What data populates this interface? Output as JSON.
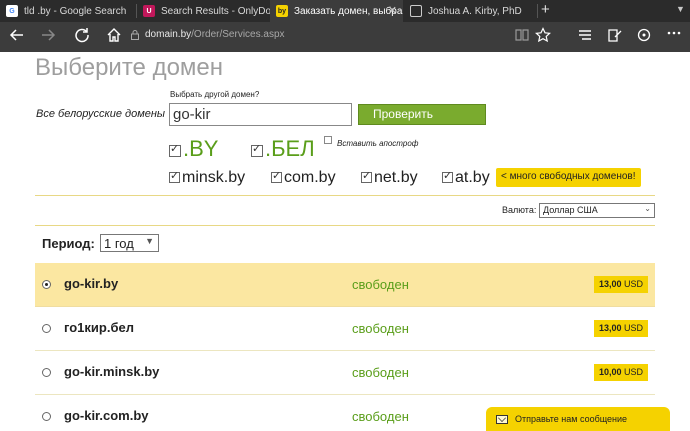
{
  "browser": {
    "tabs": [
      {
        "title": "tld .by - Google Search",
        "icon": "google-icon",
        "active": false
      },
      {
        "title": "Search Results - OnlyDomair",
        "icon": "onlydomains-icon",
        "active": false
      },
      {
        "title": "Заказать домен, выбра",
        "icon": "by-domain-icon",
        "icon_text": "by",
        "active": true
      },
      {
        "title": "Joshua A. Kirby, PhD",
        "icon": "page-icon",
        "active": false
      }
    ],
    "new_tab": "+",
    "address": {
      "host": "domain.by",
      "path": "/Order/Services.aspx"
    }
  },
  "page": {
    "title": "Выберите домен",
    "all_domains_label": "Все белорусские домены",
    "other_domain_label": "Выбрать другой домен?",
    "domain_input_value": "go-kir",
    "check_button": "Проверить",
    "zones_big": [
      ".BY",
      ".БЕЛ"
    ],
    "apostrophe_label": "Вставить апостроф",
    "zones_small": [
      "minsk.by",
      "com.by",
      "net.by",
      "at.by"
    ],
    "more_button": "< много свободных доменов!",
    "currency_label": "Валюта:",
    "currency_value": "Доллар США",
    "period_label": "Период:",
    "period_value": "1 год",
    "results": [
      {
        "domain": "go-kir.by",
        "status": "свободен",
        "price": "13,00",
        "currency": "USD",
        "selected": true
      },
      {
        "domain": "го1кир.бел",
        "status": "свободен",
        "price": "13,00",
        "currency": "USD",
        "selected": false
      },
      {
        "domain": "go-kir.minsk.by",
        "status": "свободен",
        "price": "10,00",
        "currency": "USD",
        "selected": false
      },
      {
        "domain": "go-kir.com.by",
        "status": "свободен",
        "price": "",
        "currency": "",
        "selected": false
      }
    ],
    "message_tab": "Отправьте нам сообщение"
  },
  "colors": {
    "accent_green": "#7aab2e",
    "accent_yellow": "#f5d200",
    "selected_row": "#fbe7a1",
    "status_green": "#5a9e1a"
  }
}
